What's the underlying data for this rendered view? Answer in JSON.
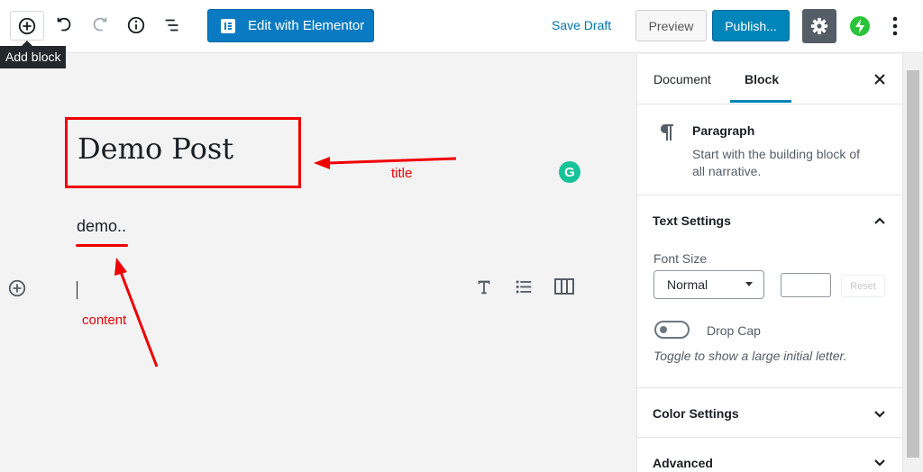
{
  "toolbar": {
    "add_block_tooltip": "Add block",
    "elementor_label": "Edit with Elementor",
    "save_draft": "Save Draft",
    "preview": "Preview",
    "publish": "Publish...",
    "colors": {
      "publish": "#0085ba",
      "elementor": "#0a7bc2",
      "accent_green": "#2ac43b"
    }
  },
  "editor": {
    "title": "Demo Post",
    "paragraph": "demo..",
    "annotations": {
      "title": "title",
      "content": "content",
      "color": "#ee0000"
    }
  },
  "sidebar": {
    "tabs": [
      "Document",
      "Block"
    ],
    "active_tab": "Block",
    "block_card": {
      "name": "Paragraph",
      "description_line1": "Start with the building block of",
      "description_line2": "all narrative."
    },
    "text_settings": {
      "title": "Text Settings",
      "font_size_label": "Font Size",
      "font_size_value": "Normal",
      "reset": "Reset",
      "drop_cap_label": "Drop Cap",
      "drop_cap_help": "Toggle to show a large initial letter."
    },
    "color_settings": "Color Settings",
    "advanced": "Advanced"
  }
}
